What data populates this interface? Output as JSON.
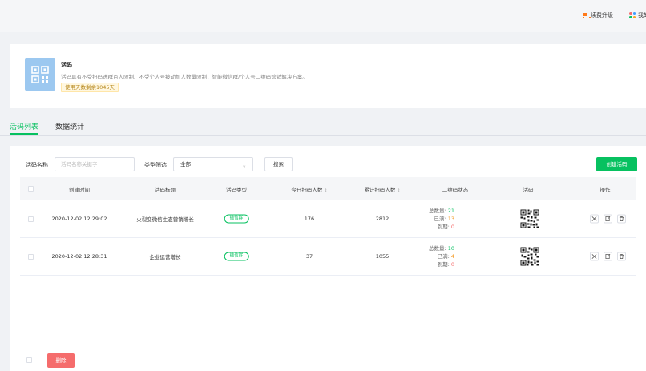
{
  "topbar": {
    "upgrade_label": "续费升级",
    "mine_label": "我的"
  },
  "info": {
    "title": "活码",
    "description": "活码具有不受扫码进群百人限制、不受个人号被动加人数量限制，智能微信群/个人号二维码营销解决方案。",
    "badge": "使用天数剩余1045天"
  },
  "tabs": [
    {
      "label": "活码列表",
      "active": true
    },
    {
      "label": "数据统计",
      "active": false
    }
  ],
  "filters": {
    "name_label": "活码名称",
    "name_placeholder": "活码名称关键字",
    "type_label": "类型筛选",
    "type_value": "全部",
    "search_label": "搜索",
    "create_label": "创建活码"
  },
  "table": {
    "headers": [
      "创建时间",
      "活码标题",
      "活码类型",
      "今日扫码人数",
      "累计扫码人数",
      "二维码状态",
      "活码",
      "操作"
    ],
    "status_labels": {
      "total": "总数量:",
      "full": "已满:",
      "expired": "到期:"
    },
    "rows": [
      {
        "created": "2020-12-02 12:29:02",
        "title": "火裂变微信生态营销增长",
        "type": "微信群",
        "today": "176",
        "total_scans": "2812",
        "total": "21",
        "full": "13",
        "expired": "0"
      },
      {
        "created": "2020-12-02 12:28:31",
        "title": "企业运营增长",
        "type": "微信群",
        "today": "37",
        "total_scans": "1055",
        "total": "10",
        "full": "4",
        "expired": "0"
      }
    ]
  },
  "footer": {
    "delete_label": "删除"
  },
  "colors": {
    "accent": "#07c160",
    "warning": "#f59a23",
    "danger": "#f56c6c",
    "upgrade": "#ff7a1a"
  }
}
